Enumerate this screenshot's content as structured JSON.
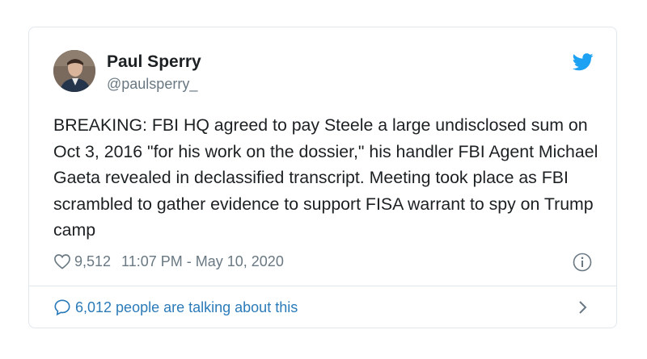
{
  "tweet": {
    "author_name": "Paul Sperry",
    "author_handle": "@paulsperry_",
    "text": "BREAKING: FBI HQ agreed to pay Steele a large undisclosed sum on Oct 3, 2016 \"for his work on the dossier,\" his handler FBI Agent Michael Gaeta revealed in declassified transcript. Meeting took place as FBI scrambled to gather evidence to support FISA warrant to spy on Trump camp",
    "likes": "9,512",
    "timestamp": "11:07 PM - May 10, 2020",
    "talking": "6,012 people are talking about this"
  },
  "icons": {
    "brand": "twitter-bird-icon",
    "like": "heart-icon",
    "info": "info-icon",
    "reply": "speech-bubble-icon",
    "navigate": "chevron-right-icon"
  },
  "colors": {
    "brand_blue": "#1da1f2",
    "link_blue": "#2b7bb9",
    "muted_text": "#697882",
    "border": "#e1e8ed"
  }
}
